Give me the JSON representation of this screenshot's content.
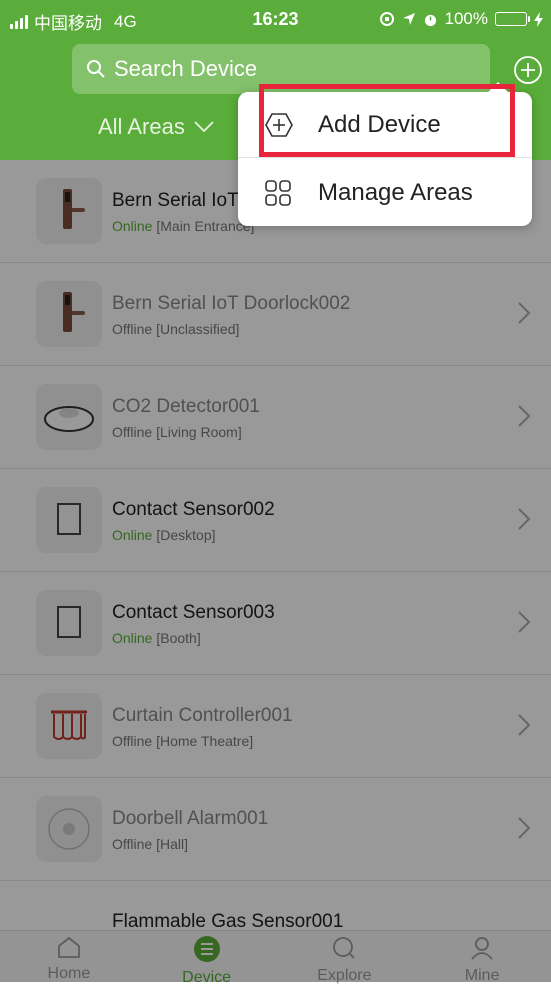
{
  "status_bar": {
    "carrier": "中国移动",
    "network": "4G",
    "time": "16:23",
    "battery": "100%"
  },
  "header": {
    "search_placeholder": "Search Device",
    "area_filter": "All Areas"
  },
  "menu": {
    "items": [
      {
        "label": "Add Device",
        "icon": "plus-circle-icon"
      },
      {
        "label": "Manage Areas",
        "icon": "grid-icon"
      }
    ]
  },
  "devices": [
    {
      "name": "Bern Serial IoT Doorlock001",
      "status": "Online",
      "area": "[Main Entrance]",
      "icon": "doorlock-icon"
    },
    {
      "name": "Bern Serial IoT Doorlock002",
      "status": "Offline",
      "area": "[Unclassified]",
      "icon": "doorlock-icon"
    },
    {
      "name": "CO2 Detector001",
      "status": "Offline",
      "area": "[Living Room]",
      "icon": "detector-icon"
    },
    {
      "name": "Contact Sensor002",
      "status": "Online",
      "area": "[Desktop]",
      "icon": "contact-sensor-icon"
    },
    {
      "name": "Contact Sensor003",
      "status": "Online",
      "area": "[Booth]",
      "icon": "contact-sensor-icon"
    },
    {
      "name": "Curtain Controller001",
      "status": "Offline",
      "area": "[Home Theatre]",
      "icon": "curtain-icon"
    },
    {
      "name": "Doorbell Alarm001",
      "status": "Offline",
      "area": "[Hall]",
      "icon": "doorbell-icon"
    },
    {
      "name": "Flammable Gas Sensor001",
      "status": "",
      "area": "",
      "icon": "gas-sensor-icon"
    }
  ],
  "tabs": [
    {
      "label": "Home",
      "icon": "home-icon"
    },
    {
      "label": "Device",
      "icon": "list-icon"
    },
    {
      "label": "Explore",
      "icon": "search-icon"
    },
    {
      "label": "Mine",
      "icon": "user-icon"
    }
  ],
  "colors": {
    "accent": "#5aad3a",
    "highlight": "#e8253a"
  }
}
